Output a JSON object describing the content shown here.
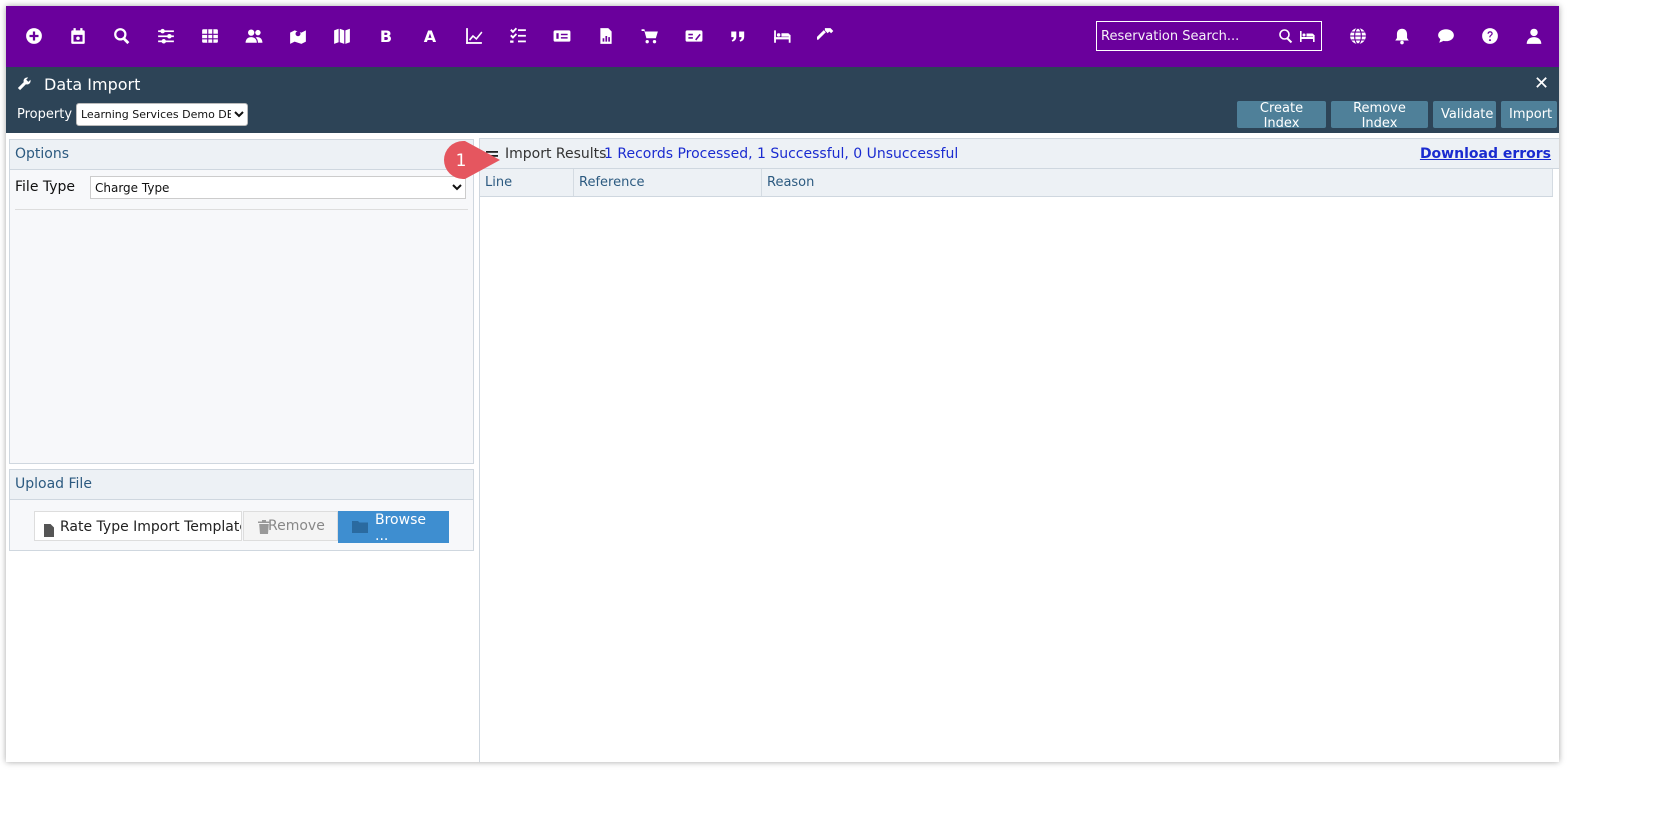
{
  "topbar": {
    "icons": [
      {
        "name": "add-icon"
      },
      {
        "name": "calendar-icon"
      },
      {
        "name": "search-icon"
      },
      {
        "name": "sliders-icon"
      },
      {
        "name": "grid-icon"
      },
      {
        "name": "users-icon"
      },
      {
        "name": "map-marker-icon"
      },
      {
        "name": "map-icon"
      },
      {
        "name": "bold-letter-icon",
        "letter": "B"
      },
      {
        "name": "letter-a-icon",
        "letter": "A"
      },
      {
        "name": "line-chart-icon"
      },
      {
        "name": "checklist-icon"
      },
      {
        "name": "card-icon"
      },
      {
        "name": "report-icon"
      },
      {
        "name": "cart-icon"
      },
      {
        "name": "payment-icon"
      },
      {
        "name": "quote-icon"
      },
      {
        "name": "bed-icon"
      },
      {
        "name": "hammer-icon"
      }
    ],
    "search_placeholder": "Reservation Search...",
    "right_icons": [
      "globe-icon",
      "bell-icon",
      "chat-icon",
      "help-icon",
      "user-icon"
    ]
  },
  "header": {
    "title": "Data Import",
    "property_label": "Property",
    "property_value": "Learning Services Demo DB",
    "buttons": {
      "create_index": "Create Index",
      "remove_index": "Remove Index",
      "validate": "Validate",
      "import": "Import"
    }
  },
  "options": {
    "title": "Options",
    "file_type_label": "File Type",
    "file_type_value": "Charge Type"
  },
  "upload": {
    "title": "Upload File",
    "file_name": "Rate Type Import Template",
    "remove_label": "Remove",
    "browse_label": "Browse ..."
  },
  "results": {
    "title": "Import Results",
    "summary": "1 Records Processed, 1 Successful, 0 Unsuccessful",
    "download_label": "Download errors",
    "columns": [
      "Line",
      "Reference",
      "Reason"
    ]
  },
  "callout": {
    "number": "1"
  },
  "colors": {
    "topbar": "#6a009c",
    "header": "#2d4457",
    "button": "#4f8099",
    "browse": "#3e8ed0",
    "callout": "#e5565f",
    "link": "#1a2bd0"
  }
}
